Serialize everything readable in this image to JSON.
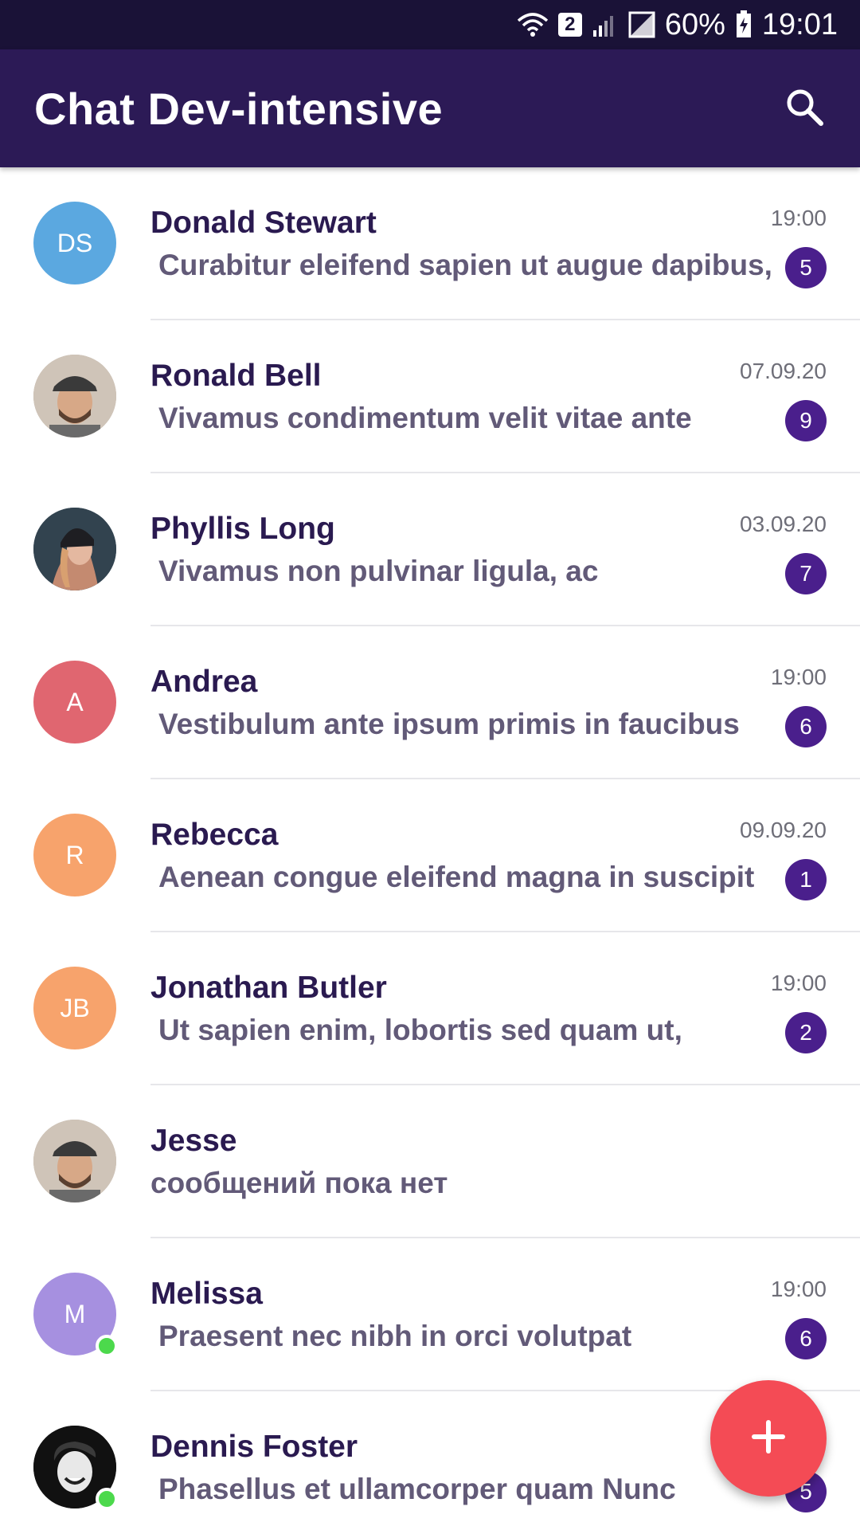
{
  "status_bar": {
    "sim_number": "2",
    "battery": "60%",
    "time": "19:01"
  },
  "app_bar": {
    "title": "Chat Dev-intensive",
    "search_icon": "search-icon"
  },
  "colors": {
    "status_bar": "#1a1237",
    "app_bar": "#2c1a56",
    "badge": "#4a1f8c",
    "fab": "#f44b55",
    "online": "#4cd94c"
  },
  "chats": [
    {
      "name": "Donald Stewart",
      "message": "Curabitur eleifend sapien ut augue dapibus,",
      "time": "19:00",
      "unread": "5",
      "initials": "DS",
      "avatar_color": "#5ba8e0",
      "online": false,
      "photo": null
    },
    {
      "name": "Ronald Bell",
      "message": "Vivamus condimentum velit vitae ante",
      "time": "07.09.20",
      "unread": "9",
      "initials": "",
      "avatar_color": "#b0a090",
      "online": false,
      "photo": "man-cap"
    },
    {
      "name": "Phyllis Long",
      "message": "Vivamus non pulvinar ligula, ac",
      "time": "03.09.20",
      "unread": "7",
      "initials": "",
      "avatar_color": "#3a4a5a",
      "online": false,
      "photo": "woman-beanie"
    },
    {
      "name": "Andrea",
      "message": "Vestibulum ante ipsum primis in faucibus",
      "time": "19:00",
      "unread": "6",
      "initials": "A",
      "avatar_color": "#e06670",
      "online": false,
      "photo": null
    },
    {
      "name": "Rebecca",
      "message": "Aenean congue eleifend magna in suscipit",
      "time": "09.09.20",
      "unread": "1",
      "initials": "R",
      "avatar_color": "#f7a36c",
      "online": false,
      "photo": null
    },
    {
      "name": "Jonathan Butler",
      "message": "Ut sapien enim, lobortis sed quam ut,",
      "time": "19:00",
      "unread": "2",
      "initials": "JB",
      "avatar_color": "#f7a36c",
      "online": false,
      "photo": null
    },
    {
      "name": "Jesse",
      "message": "сообщений пока нет",
      "time": "",
      "unread": "",
      "initials": "",
      "avatar_color": "#b0a090",
      "online": false,
      "photo": "man-cap"
    },
    {
      "name": "Melissa",
      "message": "Praesent nec nibh in orci volutpat",
      "time": "19:00",
      "unread": "6",
      "initials": "M",
      "avatar_color": "#a690e0",
      "online": true,
      "photo": null
    },
    {
      "name": "Dennis Foster",
      "message": "Phasellus et ullamcorper quam  Nunc",
      "time": "",
      "unread": "5",
      "initials": "",
      "avatar_color": "#222222",
      "online": true,
      "photo": "man-smile"
    }
  ],
  "fab": {
    "icon": "plus-icon"
  }
}
